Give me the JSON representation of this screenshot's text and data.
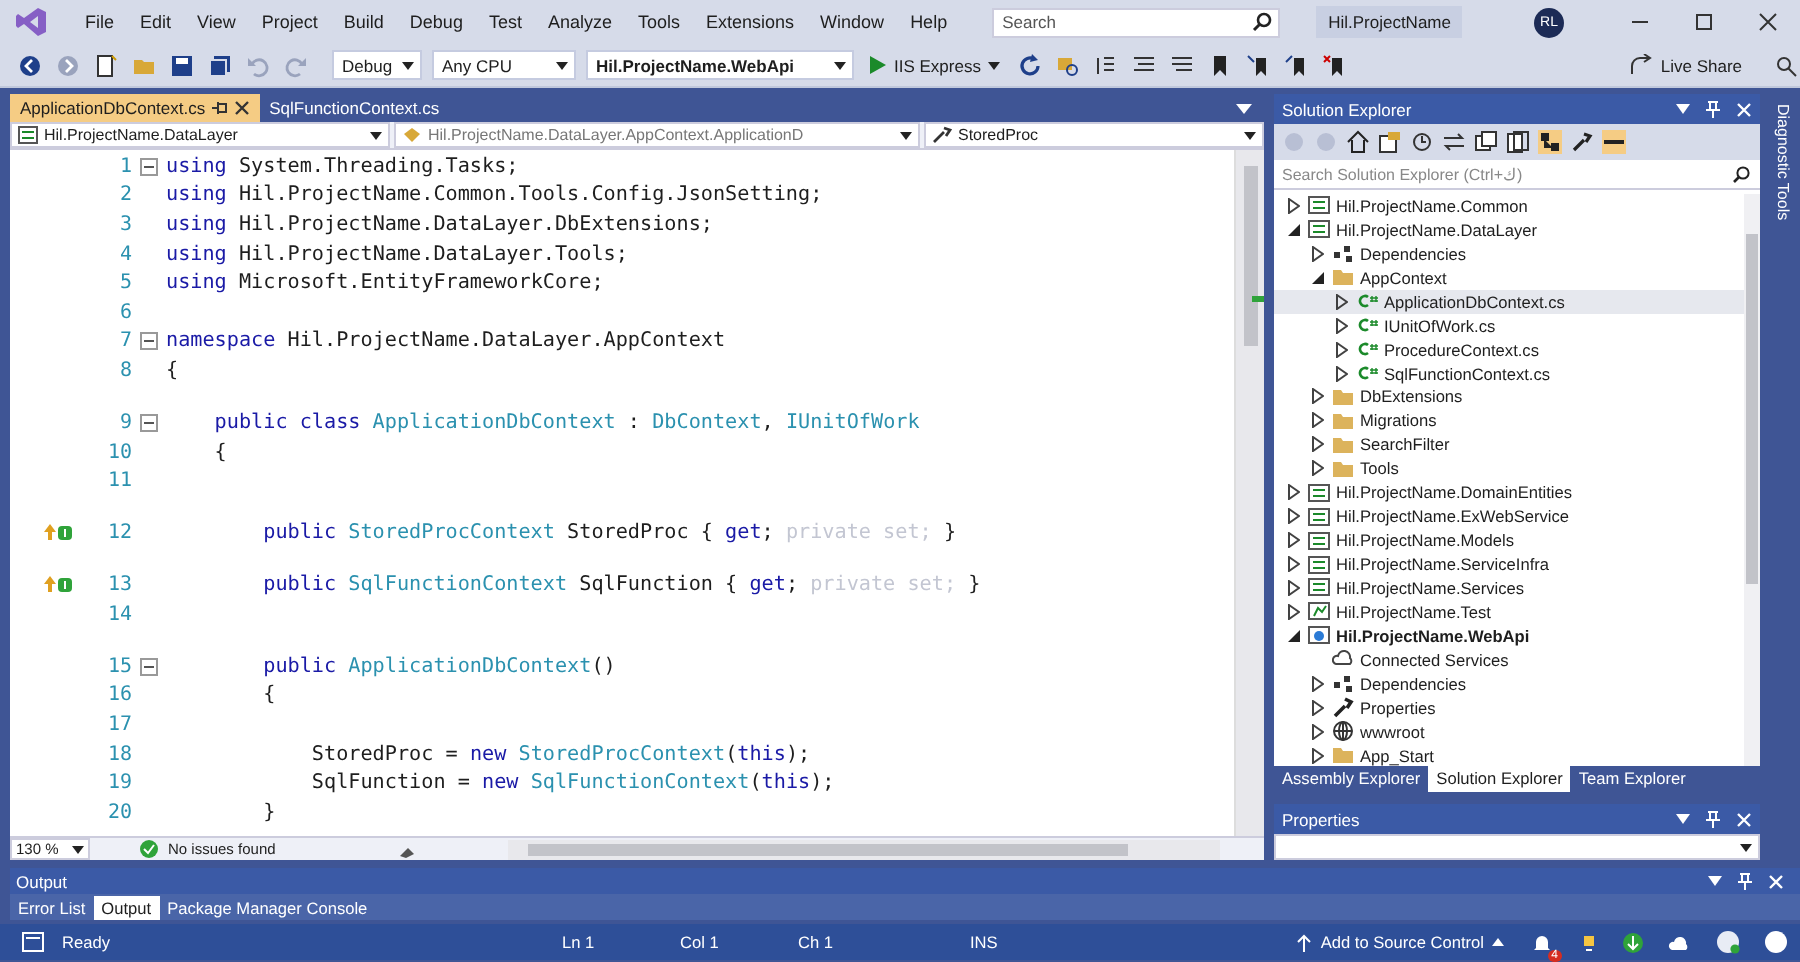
{
  "menu": {
    "items": [
      "File",
      "Edit",
      "View",
      "Project",
      "Build",
      "Debug",
      "Test",
      "Analyze",
      "Tools",
      "Extensions",
      "Window",
      "Help"
    ],
    "search": {
      "placeholder": "Search"
    },
    "title": "Hil.ProjectName",
    "user_initials": "RL"
  },
  "toolbar": {
    "configuration": "Debug",
    "platform": "Any CPU",
    "startup_project": "Hil.ProjectName.WebApi",
    "run": "IIS Express",
    "live_share": "Live Share"
  },
  "editor": {
    "tabs": [
      {
        "label": "ApplicationDbContext.cs",
        "selected": true
      },
      {
        "label": "SqlFunctionContext.cs",
        "selected": false
      }
    ],
    "nav": [
      "Hil.ProjectName.DataLayer",
      "Hil.ProjectName.DataLayer.AppContext.ApplicationD",
      "StoredProc"
    ],
    "lines": [
      {
        "number": "1",
        "spaced": false,
        "marker": false,
        "foldable": true,
        "tokens": [
          {
            "kind": "kw",
            "text": "using"
          },
          {
            "kind": "text",
            "text": " System.Threading.Tasks;"
          }
        ]
      },
      {
        "number": "2",
        "spaced": false,
        "marker": false,
        "foldable": false,
        "tokens": [
          {
            "kind": "kw",
            "text": "using"
          },
          {
            "kind": "text",
            "text": " Hil.ProjectName.Common.Tools.Config.JsonSetting;"
          }
        ]
      },
      {
        "number": "3",
        "spaced": false,
        "marker": false,
        "foldable": false,
        "tokens": [
          {
            "kind": "kw",
            "text": "using"
          },
          {
            "kind": "text",
            "text": " Hil.ProjectName.DataLayer.DbExtensions;"
          }
        ]
      },
      {
        "number": "4",
        "spaced": false,
        "marker": false,
        "foldable": false,
        "tokens": [
          {
            "kind": "kw",
            "text": "using"
          },
          {
            "kind": "text",
            "text": " Hil.ProjectName.DataLayer.Tools;"
          }
        ]
      },
      {
        "number": "5",
        "spaced": false,
        "marker": false,
        "foldable": false,
        "tokens": [
          {
            "kind": "kw",
            "text": "using"
          },
          {
            "kind": "text",
            "text": " Microsoft.EntityFrameworkCore;"
          }
        ]
      },
      {
        "number": "6",
        "spaced": false,
        "marker": false,
        "foldable": false
      },
      {
        "number": "7",
        "spaced": false,
        "marker": false,
        "foldable": true,
        "tokens": [
          {
            "kind": "kw",
            "text": "namespace"
          },
          {
            "kind": "text",
            "text": " Hil.ProjectName.DataLayer.AppContext"
          }
        ]
      },
      {
        "number": "8",
        "spaced": false,
        "marker": false,
        "foldable": false,
        "tokens": [
          {
            "kind": "text",
            "text": "{"
          }
        ]
      },
      {
        "number": "9",
        "spaced": true,
        "marker": false,
        "foldable": true,
        "tokens": [
          {
            "kind": "kw",
            "text": "    public class"
          },
          {
            "kind": "type",
            "text": " ApplicationDbContext"
          },
          {
            "kind": "text",
            "text": " : "
          },
          {
            "kind": "type",
            "text": "DbContext"
          },
          {
            "kind": "text",
            "text": ", "
          },
          {
            "kind": "type",
            "text": "IUnitOfWork"
          }
        ]
      },
      {
        "number": "10",
        "spaced": false,
        "marker": false,
        "foldable": false,
        "tokens": [
          {
            "kind": "text",
            "text": "    {"
          }
        ]
      },
      {
        "number": "11",
        "spaced": false,
        "marker": false,
        "foldable": false
      },
      {
        "number": "12",
        "spaced": true,
        "marker": true,
        "foldable": false,
        "tokens": [
          {
            "kind": "kw",
            "text": "        public"
          },
          {
            "kind": "type",
            "text": " StoredProcContext"
          },
          {
            "kind": "text",
            "text": " StoredProc { "
          },
          {
            "kind": "kw",
            "text": "get"
          },
          {
            "kind": "text",
            "text": "; "
          },
          {
            "kind": "dim",
            "text": "private set;"
          },
          {
            "kind": "text",
            "text": " }"
          }
        ]
      },
      {
        "number": "13",
        "spaced": true,
        "marker": true,
        "foldable": false,
        "tokens": [
          {
            "kind": "kw",
            "text": "        public"
          },
          {
            "kind": "type",
            "text": " SqlFunctionContext"
          },
          {
            "kind": "text",
            "text": " SqlFunction { "
          },
          {
            "kind": "kw",
            "text": "get"
          },
          {
            "kind": "text",
            "text": "; "
          },
          {
            "kind": "dim",
            "text": "private set;"
          },
          {
            "kind": "text",
            "text": " }"
          }
        ]
      },
      {
        "number": "14",
        "spaced": false,
        "marker": false,
        "foldable": false
      },
      {
        "number": "15",
        "spaced": true,
        "marker": false,
        "foldable": true,
        "tokens": [
          {
            "kind": "kw",
            "text": "        public"
          },
          {
            "kind": "type",
            "text": " ApplicationDbContext"
          },
          {
            "kind": "text",
            "text": "()"
          }
        ]
      },
      {
        "number": "16",
        "spaced": false,
        "marker": false,
        "foldable": false,
        "tokens": [
          {
            "kind": "text",
            "text": "        {"
          }
        ]
      },
      {
        "number": "17",
        "spaced": false,
        "marker": false,
        "foldable": false
      },
      {
        "number": "18",
        "spaced": false,
        "marker": false,
        "foldable": false,
        "tokens": [
          {
            "kind": "text",
            "text": "            StoredProc = "
          },
          {
            "kind": "kw",
            "text": "new"
          },
          {
            "kind": "type",
            "text": " StoredProcContext"
          },
          {
            "kind": "text",
            "text": "("
          },
          {
            "kind": "kw",
            "text": "this"
          },
          {
            "kind": "text",
            "text": ");"
          }
        ]
      },
      {
        "number": "19",
        "spaced": false,
        "marker": false,
        "foldable": false,
        "tokens": [
          {
            "kind": "text",
            "text": "            SqlFunction = "
          },
          {
            "kind": "kw",
            "text": "new"
          },
          {
            "kind": "type",
            "text": " SqlFunctionContext"
          },
          {
            "kind": "text",
            "text": "("
          },
          {
            "kind": "kw",
            "text": "this"
          },
          {
            "kind": "text",
            "text": ");"
          }
        ]
      },
      {
        "number": "20",
        "spaced": false,
        "marker": false,
        "foldable": false,
        "tokens": [
          {
            "kind": "text",
            "text": "        }"
          }
        ]
      }
    ],
    "zoom": "130 %",
    "issues": "No issues found"
  },
  "solution_explorer": {
    "title": "Solution Explorer",
    "search": {
      "placeholder": "Search Solution Explorer (Ctrl+ك)"
    },
    "tree": [
      {
        "label": "Hil.ProjectName.Common",
        "kind": "project",
        "expanded": false,
        "selected": false,
        "startup": false
      },
      {
        "label": "Hil.ProjectName.DataLayer",
        "kind": "project",
        "expanded": true,
        "selected": false,
        "startup": false,
        "children": [
          {
            "label": "Dependencies",
            "kind": "dependencies",
            "expanded": false,
            "selected": false,
            "startup": false
          },
          {
            "label": "AppContext",
            "kind": "folder",
            "expanded": true,
            "selected": false,
            "startup": false,
            "children": [
              {
                "label": "ApplicationDbContext.cs",
                "kind": "cs",
                "expanded": false,
                "selected": true,
                "startup": false
              },
              {
                "label": "IUnitOfWork.cs",
                "kind": "cs",
                "expanded": false,
                "selected": false,
                "startup": false
              },
              {
                "label": "ProcedureContext.cs",
                "kind": "cs",
                "expanded": false,
                "selected": false,
                "startup": false
              },
              {
                "label": "SqlFunctionContext.cs",
                "kind": "cs",
                "expanded": false,
                "selected": false,
                "startup": false
              }
            ]
          },
          {
            "label": "DbExtensions",
            "kind": "folder",
            "expanded": false,
            "selected": false,
            "startup": false
          },
          {
            "label": "Migrations",
            "kind": "folder",
            "expanded": false,
            "selected": false,
            "startup": false
          },
          {
            "label": "SearchFilter",
            "kind": "folder",
            "expanded": false,
            "selected": false,
            "startup": false
          },
          {
            "label": "Tools",
            "kind": "folder",
            "expanded": false,
            "selected": false,
            "startup": false
          }
        ]
      },
      {
        "label": "Hil.ProjectName.DomainEntities",
        "kind": "project",
        "expanded": false,
        "selected": false,
        "startup": false
      },
      {
        "label": "Hil.ProjectName.ExWebService",
        "kind": "project",
        "expanded": false,
        "selected": false,
        "startup": false
      },
      {
        "label": "Hil.ProjectName.Models",
        "kind": "project",
        "expanded": false,
        "selected": false,
        "startup": false
      },
      {
        "label": "Hil.ProjectName.ServiceInfra",
        "kind": "project",
        "expanded": false,
        "selected": false,
        "startup": false
      },
      {
        "label": "Hil.ProjectName.Services",
        "kind": "project",
        "expanded": false,
        "selected": false,
        "startup": false
      },
      {
        "label": "Hil.ProjectName.Test",
        "kind": "test",
        "expanded": false,
        "selected": false,
        "startup": false
      },
      {
        "label": "Hil.ProjectName.WebApi",
        "kind": "web",
        "expanded": true,
        "selected": false,
        "startup": true,
        "children": [
          {
            "label": "Connected Services",
            "kind": "connected",
            "selected": false,
            "startup": false,
            "leaf": true
          },
          {
            "label": "Dependencies",
            "kind": "dependencies",
            "expanded": false,
            "selected": false,
            "startup": false
          },
          {
            "label": "Properties",
            "kind": "properties",
            "expanded": false,
            "selected": false,
            "startup": false
          },
          {
            "label": "wwwroot",
            "kind": "globe",
            "expanded": false,
            "selected": false,
            "startup": false
          },
          {
            "label": "App_Start",
            "kind": "folder",
            "expanded": false,
            "selected": false,
            "startup": false
          }
        ]
      }
    ],
    "tabs": [
      {
        "label": "Assembly Explorer",
        "selected": false
      },
      {
        "label": "Solution Explorer",
        "selected": true
      },
      {
        "label": "Team Explorer",
        "selected": false
      }
    ]
  },
  "properties": {
    "title": "Properties"
  },
  "side_strip": "Diagnostic Tools",
  "output": {
    "title": "Output",
    "tabs": [
      {
        "label": "Error List",
        "selected": false
      },
      {
        "label": "Output",
        "selected": true
      },
      {
        "label": "Package Manager Console",
        "selected": false
      }
    ]
  },
  "status_bar": {
    "state": "Ready",
    "line": "Ln 1",
    "column": "Col 1",
    "char": "Ch 1",
    "mode": "INS",
    "source_control": "Add to Source Control",
    "notifications": "4"
  }
}
